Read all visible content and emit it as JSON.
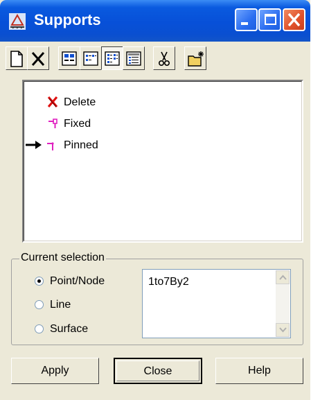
{
  "window": {
    "title": "Supports",
    "icon": "supports-app-icon",
    "controls": [
      "minimize",
      "maximize",
      "close"
    ]
  },
  "toolbar": {
    "buttons": [
      {
        "name": "new",
        "icon": "new-document-icon",
        "pressed": false
      },
      {
        "name": "delete",
        "icon": "x-icon",
        "pressed": false
      },
      {
        "name": "large-icons",
        "icon": "large-icons-view-icon",
        "pressed": false
      },
      {
        "name": "small-icons",
        "icon": "small-icons-view-icon",
        "pressed": false
      },
      {
        "name": "list",
        "icon": "list-view-icon",
        "pressed": true
      },
      {
        "name": "details",
        "icon": "details-view-icon",
        "pressed": false
      },
      {
        "name": "cut",
        "icon": "scissors-icon",
        "pressed": false
      },
      {
        "name": "new-folder",
        "icon": "new-folder-icon",
        "pressed": false
      }
    ]
  },
  "list": {
    "items": [
      {
        "label": "Delete",
        "icon": "red-x-icon",
        "current": false
      },
      {
        "label": "Fixed",
        "icon": "fixed-support-icon",
        "current": false
      },
      {
        "label": "Pinned",
        "icon": "pinned-support-icon",
        "current": true
      }
    ]
  },
  "selection": {
    "legend": "Current selection",
    "options": [
      {
        "label": "Point/Node",
        "selected": true
      },
      {
        "label": "Line",
        "selected": false
      },
      {
        "label": "Surface",
        "selected": false
      }
    ],
    "value": "1to7By2"
  },
  "buttons": {
    "apply": "Apply",
    "close": "Close",
    "help": "Help"
  },
  "colors": {
    "titlebar": "#0a5adf",
    "close_button": "#e0502a",
    "face": "#ece9d8",
    "support_icon": "#e020c0",
    "delete_icon": "#e01010"
  }
}
